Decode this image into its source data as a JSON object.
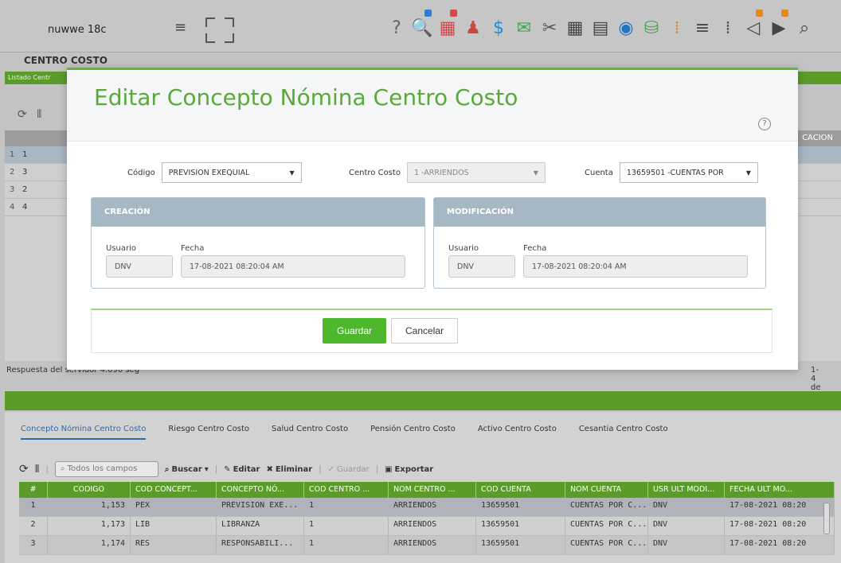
{
  "topbar": {
    "app_title": "nuwwe 18c",
    "icons": [
      {
        "name": "help-circle-icon",
        "glyph": "?",
        "color": "#666666"
      },
      {
        "name": "search-doc-icon",
        "glyph": "🔍",
        "color": "#2f7dd6"
      },
      {
        "name": "report-icon",
        "glyph": "▦",
        "color": "#d04a4a"
      },
      {
        "name": "person-icon",
        "glyph": "♟",
        "color": "#c64b3a"
      },
      {
        "name": "dollar-icon",
        "glyph": "$",
        "color": "#1f8fd6"
      },
      {
        "name": "mail-icon",
        "glyph": "✉",
        "color": "#3fa64a"
      },
      {
        "name": "tools-icon",
        "glyph": "✂",
        "color": "#555555"
      },
      {
        "name": "grid-icon",
        "glyph": "▦",
        "color": "#444444"
      },
      {
        "name": "clipboard-icon",
        "glyph": "▤",
        "color": "#444444"
      },
      {
        "name": "dashboard-icon",
        "glyph": "◉",
        "color": "#1f74c6"
      },
      {
        "name": "database-icon",
        "glyph": "⛁",
        "color": "#3fa64a"
      },
      {
        "name": "dots-grid-icon",
        "glyph": "⁞",
        "color": "#e08a1f"
      },
      {
        "name": "list-icon",
        "glyph": "≡",
        "color": "#444444"
      },
      {
        "name": "dots-grid-gray-icon",
        "glyph": "⁞",
        "color": "#555555"
      },
      {
        "name": "megaphone-icon",
        "glyph": "◁",
        "color": "#444444"
      },
      {
        "name": "play-box-icon",
        "glyph": "▶",
        "color": "#444444"
      },
      {
        "name": "search-icon",
        "glyph": "⌕",
        "color": "#444444"
      }
    ]
  },
  "background": {
    "section_title": "CENTRO COSTO",
    "strip_label": "Listado Centr",
    "column_partial": "CACION",
    "rows": [
      {
        "n": "1",
        "v": "1"
      },
      {
        "n": "2",
        "v": "3"
      },
      {
        "n": "3",
        "v": "2"
      },
      {
        "n": "4",
        "v": "4"
      }
    ],
    "status": "Respuesta del servidor 4.090 seg",
    "range": "1-4 de"
  },
  "modal": {
    "title": "Editar Concepto Nómina Centro Costo",
    "help": "?",
    "codigo_label": "Código",
    "codigo_value": "PREVISION EXEQUIAL",
    "centro_costo_label": "Centro Costo",
    "centro_costo_value": "1 -ARRIENDOS",
    "cuenta_label": "Cuenta",
    "cuenta_value": "13659501 -CUENTAS POR",
    "creacion": {
      "header": "CREACIÓN",
      "usuario_label": "Usuario",
      "usuario_value": "DNV",
      "fecha_label": "Fecha",
      "fecha_value": "17-08-2021 08:20:04 AM"
    },
    "modificacion": {
      "header": "MODIFICACIÓN",
      "usuario_label": "Usuario",
      "usuario_value": "DNV",
      "fecha_label": "Fecha",
      "fecha_value": "17-08-2021 08:20:04 AM"
    },
    "save_label": "Guardar",
    "cancel_label": "Cancelar"
  },
  "lower": {
    "tabs": [
      "Concepto Nómina Centro Costo",
      "Riesgo Centro Costo",
      "Salud Centro Costo",
      "Pensión Centro Costo",
      "Activo Centro Costo",
      "Cesantia Centro Costo"
    ],
    "search_placeholder": "Todos los campos",
    "buscar": "Buscar",
    "editar": "Editar",
    "eliminar": "Eliminar",
    "guardar": "Guardar",
    "exportar": "Exportar",
    "columns": [
      "#",
      "CODIGO",
      "COD CONCEPT...",
      "CONCEPTO NÓ...",
      "COD CENTRO ...",
      "NOM CENTRO ...",
      "COD CUENTA",
      "NOM CUENTA",
      "USR ULT MODI...",
      "FECHA ULT MO..."
    ],
    "rows": [
      [
        "1",
        "1,153",
        "PEX",
        "PREVISION EXE...",
        "1",
        "ARRIENDOS",
        "13659501",
        "CUENTAS POR C...",
        "DNV",
        "17-08-2021 08:20"
      ],
      [
        "2",
        "1,173",
        "LIB",
        "LIBRANZA",
        "1",
        "ARRIENDOS",
        "13659501",
        "CUENTAS POR C...",
        "DNV",
        "17-08-2021 08:20"
      ],
      [
        "3",
        "1,174",
        "RES",
        "RESPONSABILI...",
        "1",
        "ARRIENDOS",
        "13659501",
        "CUENTAS POR C...",
        "DNV",
        "17-08-2021 08:20"
      ]
    ]
  }
}
